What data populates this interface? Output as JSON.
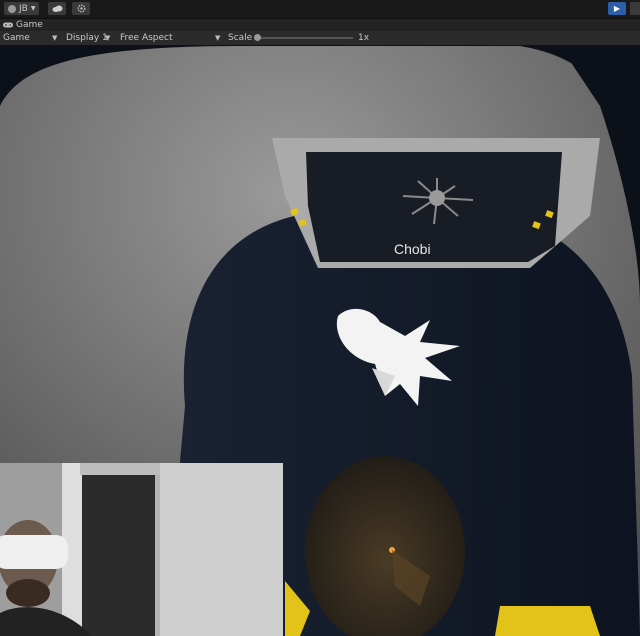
{
  "toolbar_top": {
    "account_label": "JB",
    "account_icon": "user-circle-icon",
    "cloud_icon": "cloud-icon",
    "settings_icon": "gear-icon",
    "play_icon": "play-icon"
  },
  "tab": {
    "icon": "gamepad-icon",
    "label": "Game"
  },
  "game_toolbar": {
    "mode": "Game",
    "display": "Display 1",
    "aspect": "Free Aspect",
    "scale_label": "Scale",
    "scale_value": "1x",
    "scale_level": 0.0
  },
  "scene": {
    "sign_text": "Chobi",
    "accent": "#e3c21a"
  }
}
